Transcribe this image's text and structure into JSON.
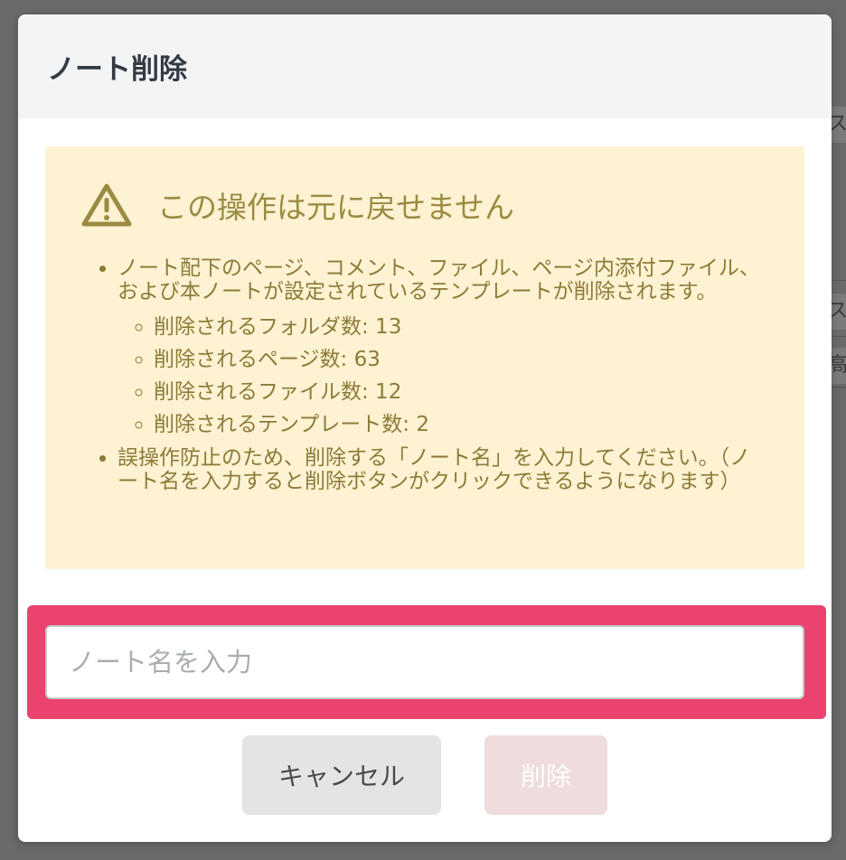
{
  "dialog": {
    "title": "ノート削除"
  },
  "warning": {
    "title": "この操作は元に戻せません",
    "intro": "ノート配下のページ、コメント、ファイル、ページ内添付ファイル、および本ノートが設定されているテンプレートが削除されます。",
    "counts": [
      "削除されるフォルダ数: 13",
      "削除されるページ数: 63",
      "削除されるファイル数: 12",
      "削除されるテンプレート数: 2"
    ],
    "instruction": "誤操作防止のため、削除する「ノート名」を入力してください。（ノート名を入力すると削除ボタンがクリックできるようになります）"
  },
  "input": {
    "placeholder": "ノート名を入力",
    "value": ""
  },
  "buttons": {
    "cancel": "キャンセル",
    "delete": "削除"
  },
  "background": {
    "fragments": [
      "ス",
      "ス",
      "高"
    ]
  },
  "colors": {
    "warning_bg": "#fdf3d3",
    "warning_text": "#8d7a37",
    "highlight": "#ea436e",
    "delete_disabled_bg": "#efdcdc",
    "cancel_bg": "#e4e4e4"
  },
  "icons": {
    "warning": "warning-triangle-icon"
  }
}
